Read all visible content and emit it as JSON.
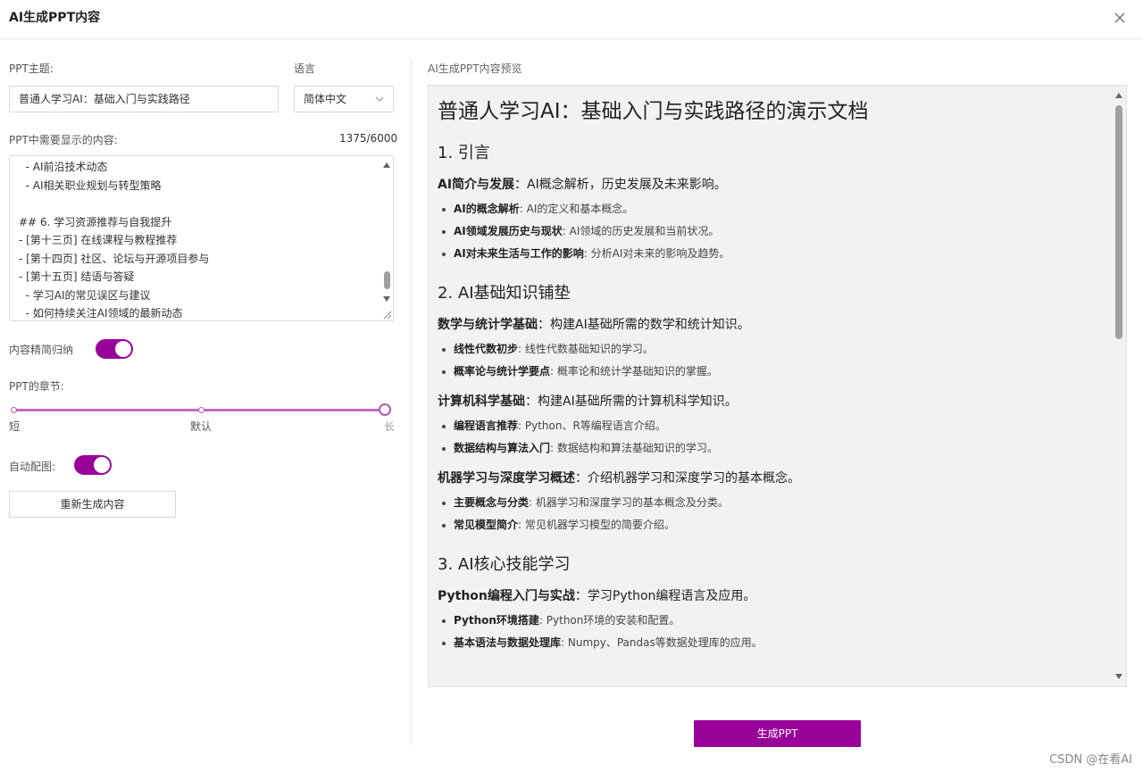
{
  "dialog": {
    "title": "AI生成PPT内容",
    "close_icon": "close-icon"
  },
  "form": {
    "topic_label": "PPT主题:",
    "topic_value": "普通人学习AI：基础入门与实践路径",
    "language_label": "语言",
    "language_value": "简体中文",
    "content_label": "PPT中需要显示的内容:",
    "content_count": "1375/6000",
    "content_lines": [
      "  - AI前沿技术动态",
      "  - AI相关职业规划与转型策略",
      "",
      "## 6. 学习资源推荐与自我提升",
      "- [第十三页] 在线课程与教程推荐",
      "- [第十四页] 社区、论坛与开源项目参与",
      "- [第十五页] 结语与答疑",
      "  - 学习AI的常见误区与建议",
      "  - 如何持续关注AI领域的最新动态"
    ],
    "condense_label": "内容精简归纳",
    "condense_on": true,
    "chapters_label": "PPT的章节:",
    "chapters_options": [
      "短",
      "默认",
      "长"
    ],
    "chapters_selected": "长",
    "auto_image_label": "自动配图:",
    "auto_image_on": true,
    "regenerate_label": "重新生成内容"
  },
  "preview": {
    "label": "AI生成PPT内容预览",
    "doc_title": "普通人学习AI：基础入门与实践路径的演示文档",
    "sections": [
      {
        "heading": "1. 引言",
        "groups": [
          {
            "title": "AI简介与发展",
            "desc": "：AI概念解析，历史发展及未来影响。",
            "items": [
              {
                "b": "AI的概念解析",
                "t": ": AI的定义和基本概念。"
              },
              {
                "b": "AI领域发展历史与现状",
                "t": ": AI领域的历史发展和当前状况。"
              },
              {
                "b": "AI对未来生活与工作的影响",
                "t": ": 分析AI对未来的影响及趋势。"
              }
            ]
          }
        ]
      },
      {
        "heading": "2. AI基础知识铺垫",
        "groups": [
          {
            "title": "数学与统计学基础",
            "desc": "：构建AI基础所需的数学和统计知识。",
            "items": [
              {
                "b": "线性代数初步",
                "t": ": 线性代数基础知识的学习。"
              },
              {
                "b": "概率论与统计学要点",
                "t": ": 概率论和统计学基础知识的掌握。"
              }
            ]
          },
          {
            "title": "计算机科学基础",
            "desc": "：构建AI基础所需的计算机科学知识。",
            "items": [
              {
                "b": "编程语言推荐",
                "t": ": Python、R等编程语言介绍。"
              },
              {
                "b": "数据结构与算法入门",
                "t": ": 数据结构和算法基础知识的学习。"
              }
            ]
          },
          {
            "title": "机器学习与深度学习概述",
            "desc": "：介绍机器学习和深度学习的基本概念。",
            "items": [
              {
                "b": "主要概念与分类",
                "t": ": 机器学习和深度学习的基本概念及分类。"
              },
              {
                "b": "常见模型简介",
                "t": ": 常见机器学习模型的简要介绍。"
              }
            ]
          }
        ]
      },
      {
        "heading": "3. AI核心技能学习",
        "groups": [
          {
            "title": "Python编程入门与实战",
            "desc": "：学习Python编程语言及应用。",
            "items": [
              {
                "b": "Python环境搭建",
                "t": ": Python环境的安装和配置。"
              },
              {
                "b": "基本语法与数据处理库",
                "t": ": Numpy、Pandas等数据处理库的应用。"
              }
            ]
          }
        ]
      }
    ]
  },
  "actions": {
    "generate_label": "生成PPT"
  },
  "watermark": "CSDN @在看AI",
  "colors": {
    "accent": "#99009a",
    "slider": "#c36ac7",
    "preview_bg": "#f2f2f2"
  }
}
